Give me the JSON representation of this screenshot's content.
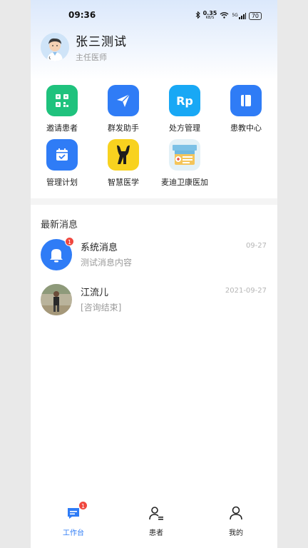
{
  "status_bar": {
    "time": "09:36",
    "network_speed": "0.35",
    "network_unit": "KB/S",
    "signal_label": "5G",
    "battery": "70"
  },
  "profile": {
    "name": "张三测试",
    "title": "主任医师"
  },
  "shortcuts": [
    {
      "label": "邀请患者",
      "icon": "qr-code-icon",
      "color": "#1fc27d"
    },
    {
      "label": "群发助手",
      "icon": "paper-plane-icon",
      "color": "#2f7cf6"
    },
    {
      "label": "处方管理",
      "icon": "rp-icon",
      "icon_text": "Rp",
      "color": "#18a8f5"
    },
    {
      "label": "患教中心",
      "icon": "book-icon",
      "color": "#2f7cf6"
    },
    {
      "label": "管理计划",
      "icon": "calendar-check-icon",
      "color": "#2f7cf6"
    },
    {
      "label": "智慧医学",
      "icon": "giraffe-logo-icon",
      "color": "#f8d21f"
    },
    {
      "label": "麦迪卫康医加",
      "icon": "medical-kit-icon",
      "color": "#e3f1f7"
    }
  ],
  "messages_section": {
    "title": "最新消息",
    "items": [
      {
        "name": "系统消息",
        "text": "测试消息内容",
        "time": "09-27",
        "badge": "1",
        "avatar": "bell-icon"
      },
      {
        "name": "江流儿",
        "text": "[咨询结束]",
        "time": "2021-09-27",
        "avatar": "user-photo"
      }
    ]
  },
  "tab_bar": {
    "active_color": "#2f7cf6",
    "tabs": [
      {
        "label": "工作台",
        "badge": "1",
        "active": true
      },
      {
        "label": "患者",
        "active": false
      },
      {
        "label": "我的",
        "active": false
      }
    ]
  }
}
